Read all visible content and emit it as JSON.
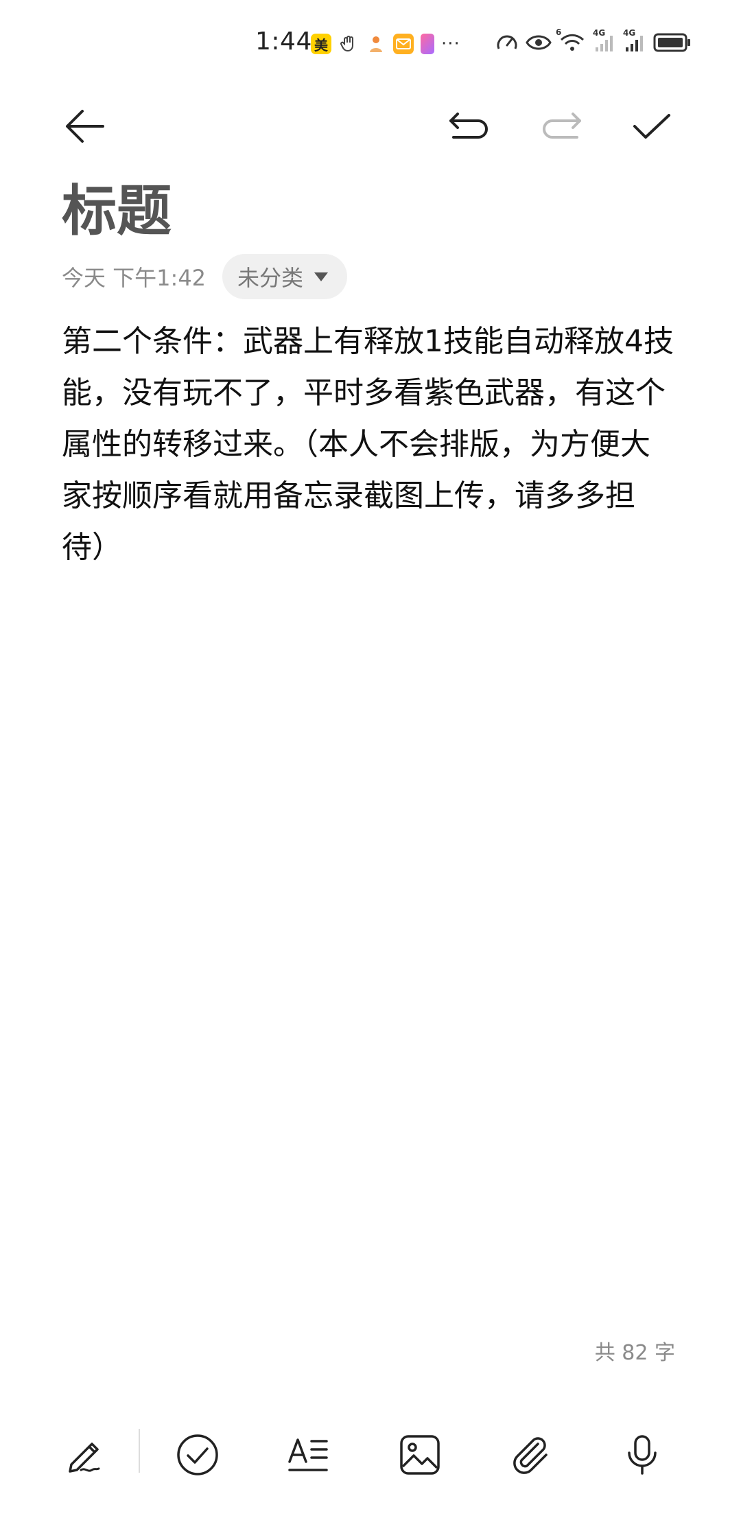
{
  "status_bar": {
    "time": "1:44",
    "notification_icons": [
      {
        "name": "meituan-icon",
        "label": "美"
      },
      {
        "name": "hand-icon"
      },
      {
        "name": "app-person-icon"
      },
      {
        "name": "mail-icon"
      },
      {
        "name": "book-app-icon"
      }
    ],
    "more": "···",
    "network_badge_1": "6",
    "network_badge_2": "4G",
    "network_badge_3": "4G"
  },
  "note": {
    "title": "标题",
    "date": "今天 下午1:42",
    "category": "未分类",
    "body": "第二个条件：武器上有释放1技能自动释放4技能，没有玩不了，平时多看紫色武器，有这个属性的转移过来。（本人不会排版，为方便大家按顺序看就用备忘录截图上传，请多多担待）",
    "word_count": "共 82 字"
  },
  "colors": {
    "title": "#555555",
    "meta": "#8a8a8a",
    "chip_bg": "#f0f0f0",
    "disabled_icon": "#bbbbbb"
  }
}
